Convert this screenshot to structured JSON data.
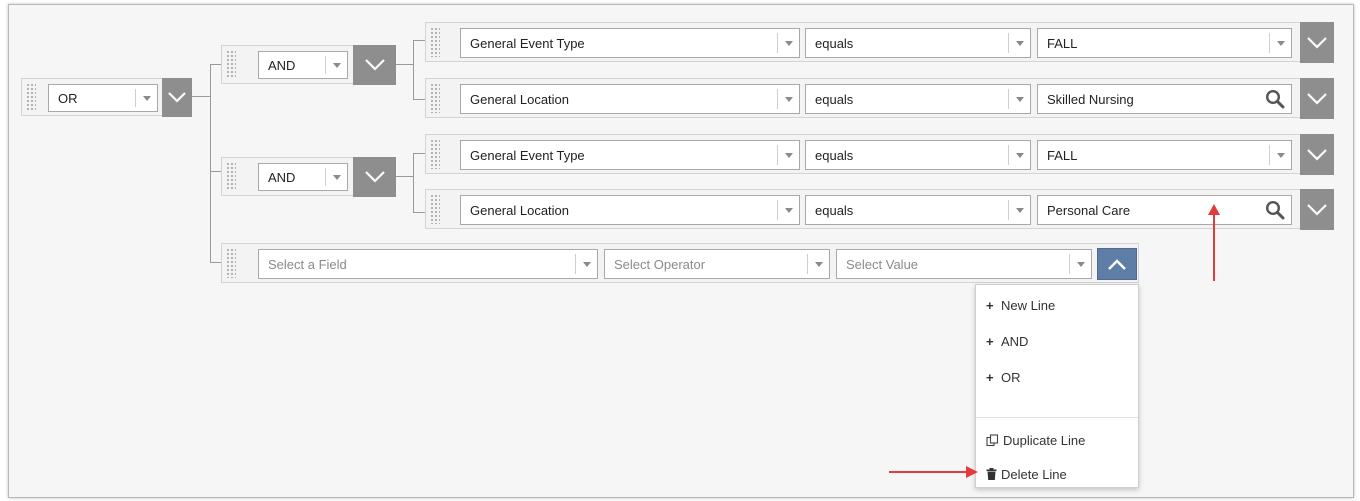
{
  "root_group": {
    "operator": "OR"
  },
  "groups": [
    {
      "operator": "AND",
      "conditions": [
        {
          "field": "General Event Type",
          "operator": "equals",
          "value": "FALL",
          "value_control": "dropdown"
        },
        {
          "field": "General Location",
          "operator": "equals",
          "value": "Skilled Nursing",
          "value_control": "search"
        }
      ]
    },
    {
      "operator": "AND",
      "conditions": [
        {
          "field": "General Event Type",
          "operator": "equals",
          "value": "FALL",
          "value_control": "dropdown"
        },
        {
          "field": "General Location",
          "operator": "equals",
          "value": "Personal Care",
          "value_control": "search"
        }
      ]
    }
  ],
  "new_line": {
    "field_placeholder": "Select a Field",
    "operator_placeholder": "Select Operator",
    "value_placeholder": "Select Value"
  },
  "context_menu": {
    "items": [
      {
        "icon": "plus-icon",
        "label": "New Line"
      },
      {
        "icon": "plus-icon",
        "label": "AND"
      },
      {
        "icon": "plus-icon",
        "label": "OR"
      },
      {
        "icon": "duplicate-icon",
        "label": "Duplicate Line"
      },
      {
        "icon": "trash-icon",
        "label": "Delete Line"
      }
    ]
  },
  "colors": {
    "canvas_bg": "#f6f6f6",
    "menu_button_gray": "#8e8e8e",
    "menu_button_active_blue": "#5e7ea8",
    "annotation_arrow_red": "#e23b3b"
  }
}
